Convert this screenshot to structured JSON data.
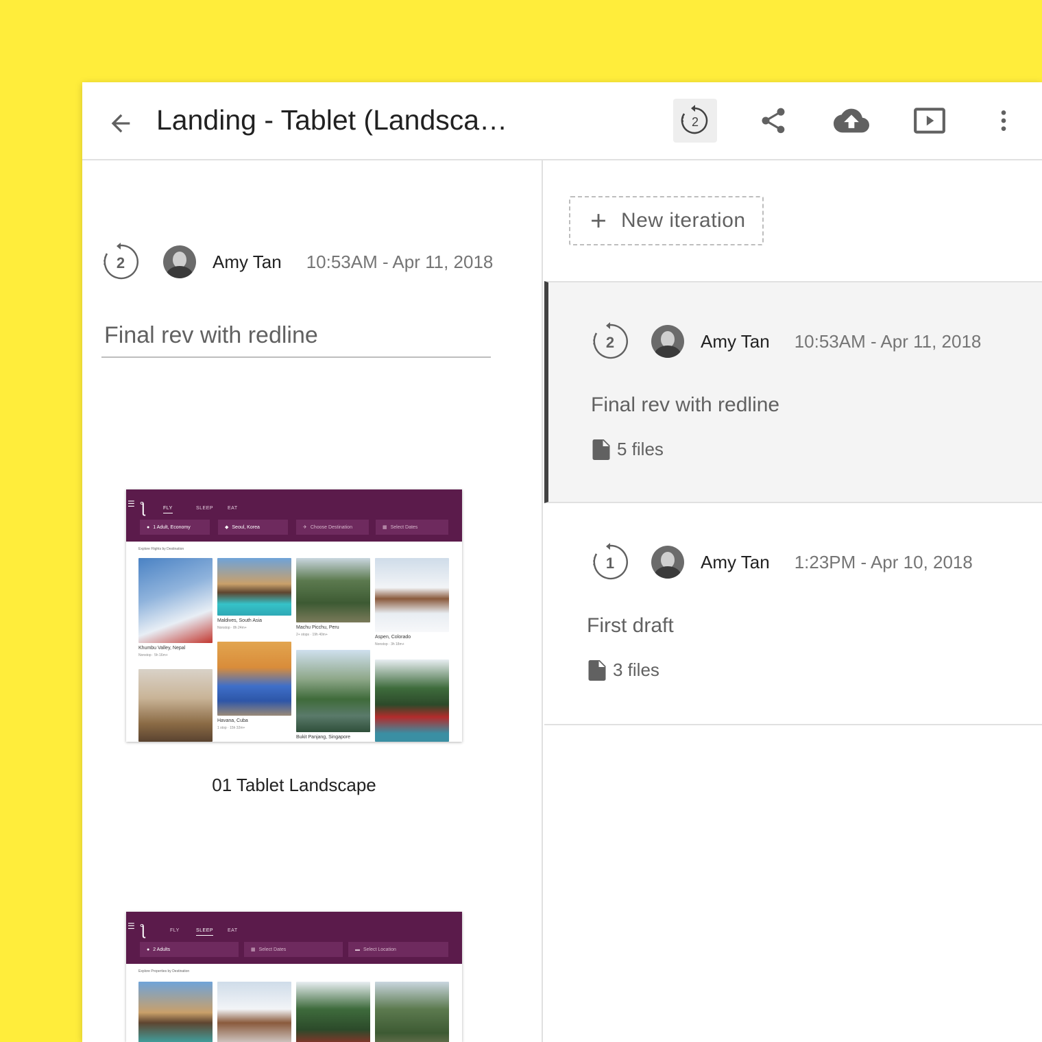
{
  "header": {
    "title": "Landing - Tablet (Landsca…",
    "history_badge": "2",
    "actions": [
      "history-icon",
      "share-icon",
      "cloud-upload-icon",
      "present-icon",
      "more-vert-icon"
    ]
  },
  "detail": {
    "iteration_number": "2",
    "author": "Amy Tan",
    "timestamp": "10:53AM - Apr 11, 2018",
    "note": "Final rev with redline",
    "artboards": [
      {
        "caption": "01 Tablet Landscape",
        "tabs": [
          "FLY",
          "SLEEP",
          "EAT"
        ],
        "fields": [
          "1 Adult, Economy",
          "Seoul, Korea",
          "Choose Destination",
          "Select Dates"
        ],
        "section": "Explore Flights by Destination",
        "tiles": [
          {
            "label": "Khumbu Valley, Nepal",
            "sub": "Nonstop · 5h 16m+"
          },
          {
            "label": "Maldives, South Asia",
            "sub": "Nonstop · 8h 24m+"
          },
          {
            "label": "Machu Picchu, Peru",
            "sub": "2+ stops · 19h 40m+"
          },
          {
            "label": "Aspen, Colorado",
            "sub": "Nonstop · 3h 18m+"
          },
          {
            "label": "Havana, Cuba",
            "sub": "1 stop · 15h 32m+"
          },
          {
            "label": "Bukit Panjang, Singapore",
            "sub": ""
          }
        ]
      },
      {
        "caption": "",
        "tabs": [
          "FLY",
          "SLEEP",
          "EAT"
        ],
        "fields": [
          "2 Adults",
          "Select Dates",
          "Select Location"
        ],
        "section": "Explore Properties by Destination"
      }
    ]
  },
  "sidebar": {
    "new_iteration_label": "New iteration",
    "iterations": [
      {
        "number": "2",
        "author": "Amy Tan",
        "timestamp": "10:53AM - Apr 11, 2018",
        "note": "Final rev with redline",
        "files": "5 files",
        "selected": true
      },
      {
        "number": "1",
        "author": "Amy Tan",
        "timestamp": "1:23PM - Apr 10, 2018",
        "note": "First draft",
        "files": "3 files",
        "selected": false
      }
    ]
  },
  "colors": {
    "background": "#FFED3B",
    "artboard_header": "#5b1b4b",
    "selected_row": "#f4f4f4",
    "selected_indicator": "#424242"
  }
}
